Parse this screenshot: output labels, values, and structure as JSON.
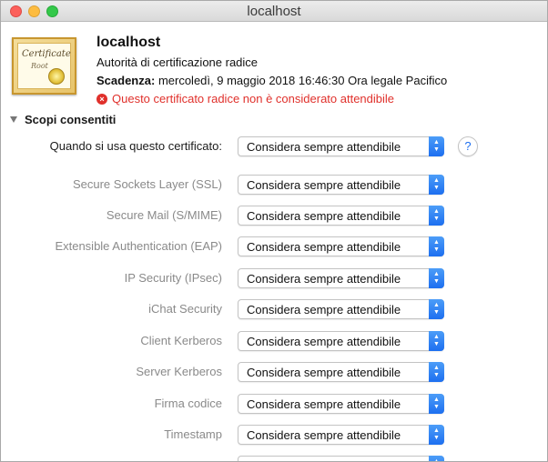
{
  "window": {
    "title": "localhost"
  },
  "certificate": {
    "icon_text_1": "Certificate",
    "icon_text_2": "Root",
    "name": "localhost",
    "type": "Autorità di certificazione radice",
    "expiry_label": "Scadenza:",
    "expiry_value": "mercoledì, 9 maggio 2018 16:46:30 Ora legale Pacifico",
    "warning": "Questo certificato radice non è considerato attendibile",
    "warning_icon": "×"
  },
  "section": {
    "title": "Scopi consentiti"
  },
  "trust": {
    "help_label": "?",
    "rows": [
      {
        "label": "Quando si usa questo certificato:",
        "value": "Considera sempre attendibile"
      },
      {
        "label": "Secure Sockets Layer (SSL)",
        "value": "Considera sempre attendibile"
      },
      {
        "label": "Secure Mail (S/MIME)",
        "value": "Considera sempre attendibile"
      },
      {
        "label": "Extensible Authentication (EAP)",
        "value": "Considera sempre attendibile"
      },
      {
        "label": "IP Security (IPsec)",
        "value": "Considera sempre attendibile"
      },
      {
        "label": "iChat Security",
        "value": "Considera sempre attendibile"
      },
      {
        "label": "Client Kerberos",
        "value": "Considera sempre attendibile"
      },
      {
        "label": "Server Kerberos",
        "value": "Considera sempre attendibile"
      },
      {
        "label": "Firma codice",
        "value": "Considera sempre attendibile"
      },
      {
        "label": "Timestamp",
        "value": "Considera sempre attendibile"
      }
    ]
  }
}
